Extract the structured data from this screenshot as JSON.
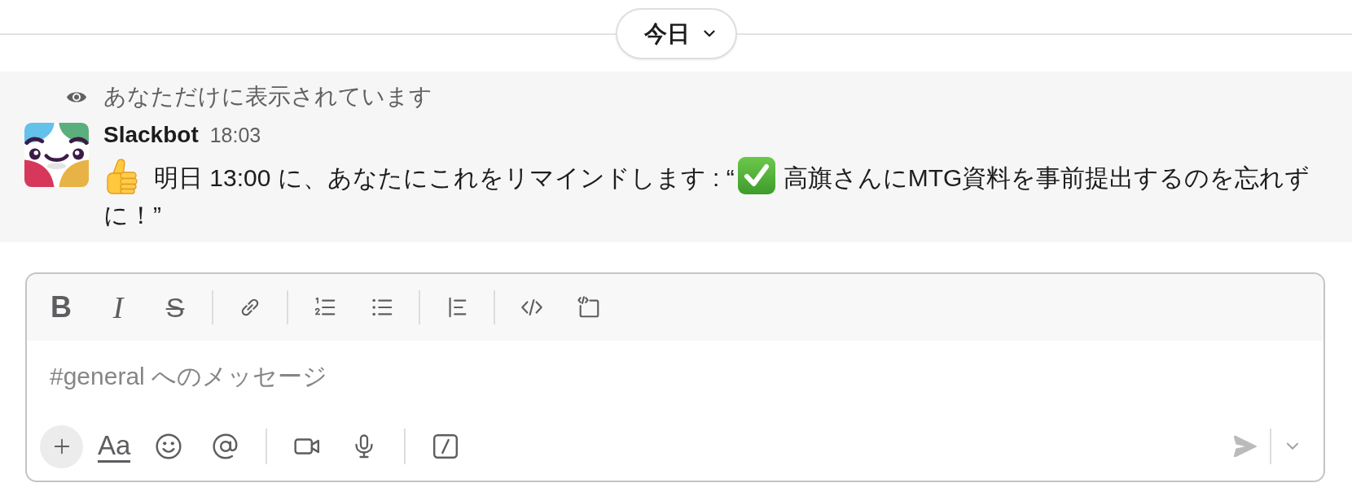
{
  "date_divider": {
    "label": "今日"
  },
  "ephemeral_notice": {
    "text": "あなただけに表示されています"
  },
  "message": {
    "sender": "Slackbot",
    "time": "18:03",
    "body": [
      "明日 13:00 に、あなたにこれをリマインドします : “",
      "高旗さんにMTG資料を事前提出するのを忘れずに！”"
    ]
  },
  "composer": {
    "format_buttons": [
      {
        "kind": "bold",
        "label": "B"
      },
      {
        "kind": "italic",
        "label": "I"
      },
      {
        "kind": "strike",
        "label": "S"
      }
    ],
    "placeholder": "#general へのメッセージ",
    "text_format_button": {
      "label": "Aa"
    },
    "send_button": {
      "disabled": true
    }
  }
}
